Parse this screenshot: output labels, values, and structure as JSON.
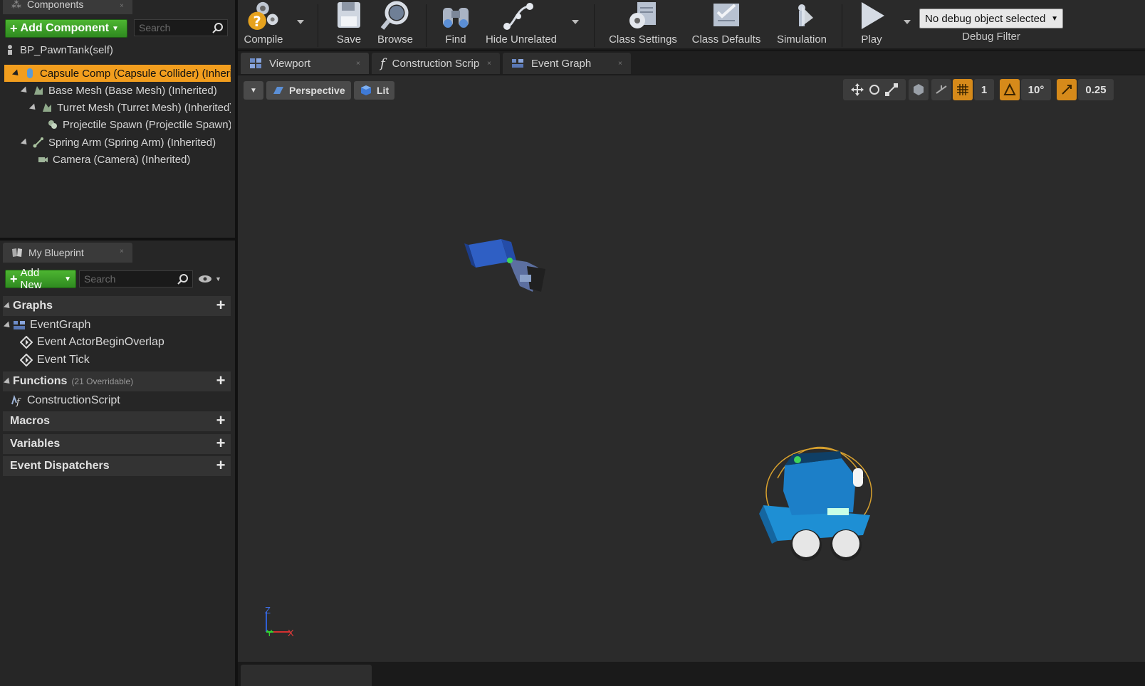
{
  "components_panel": {
    "title": "Components",
    "add_component_label": "Add Component",
    "search_placeholder": "Search",
    "self_label": "BP_PawnTank(self)",
    "tree": [
      {
        "label": "Capsule Comp (Capsule Collider) (Inherited)",
        "icon": "capsule-icon",
        "selected": true
      },
      {
        "label": "Base Mesh (Base Mesh) (Inherited)",
        "icon": "static-mesh-icon"
      },
      {
        "label": "Turret Mesh (Turret Mesh) (Inherited)",
        "icon": "static-mesh-icon"
      },
      {
        "label": "Projectile Spawn (Projectile Spawn) (Inherited)",
        "icon": "scene-component-icon"
      },
      {
        "label": "Spring Arm (Spring Arm) (Inherited)",
        "icon": "spring-arm-icon"
      },
      {
        "label": "Camera (Camera) (Inherited)",
        "icon": "camera-icon"
      }
    ]
  },
  "my_blueprint": {
    "title": "My Blueprint",
    "add_new_label": "Add New",
    "search_placeholder": "Search",
    "graphs_label": "Graphs",
    "event_graph_label": "EventGraph",
    "events": [
      "Event ActorBeginOverlap",
      "Event Tick"
    ],
    "functions_label": "Functions",
    "functions_sub": "(21 Overridable)",
    "construction_script_label": "ConstructionScript",
    "macros_label": "Macros",
    "variables_label": "Variables",
    "dispatchers_label": "Event Dispatchers"
  },
  "toolbar": {
    "compile": "Compile",
    "save": "Save",
    "browse": "Browse",
    "find": "Find",
    "hide_unrelated": "Hide Unrelated",
    "class_settings": "Class Settings",
    "class_defaults": "Class Defaults",
    "simulation": "Simulation",
    "play": "Play",
    "debug_object": "No debug object selected",
    "debug_filter": "Debug Filter"
  },
  "tabs": {
    "viewport": "Viewport",
    "construction": "Construction Scrip",
    "event_graph": "Event Graph"
  },
  "viewport": {
    "perspective": "Perspective",
    "lit": "Lit",
    "grid_size": "1",
    "rotation_snap": "10°",
    "scale_snap": "0.25",
    "axis_z": "Z",
    "axis_y": "Y",
    "axis_x": "X"
  },
  "colors": {
    "selection": "#f29e1e",
    "green_button": "#3a9a2a",
    "tank_body": "#1e7fc4"
  }
}
